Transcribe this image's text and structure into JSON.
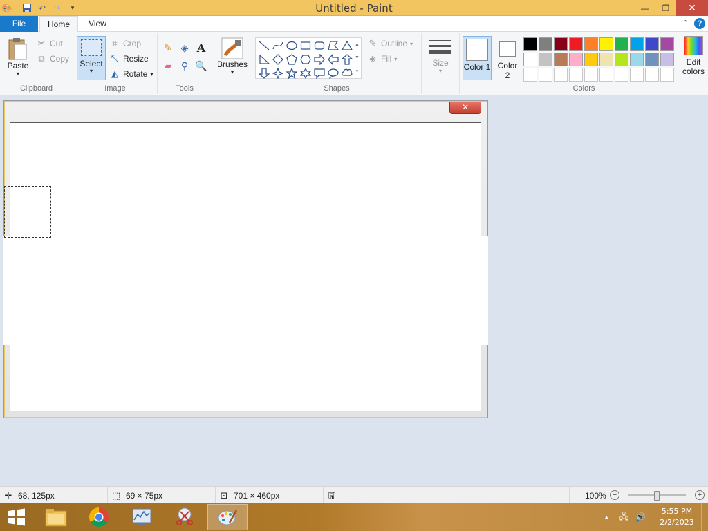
{
  "window": {
    "title": "Untitled - Paint",
    "minimize_glyph": "—",
    "restore_glyph": "❐",
    "close_glyph": "✕"
  },
  "tabs": {
    "file": "File",
    "home": "Home",
    "view": "View"
  },
  "clipboard": {
    "paste": "Paste",
    "cut": "Cut",
    "copy": "Copy",
    "group": "Clipboard"
  },
  "image": {
    "select": "Select",
    "crop": "Crop",
    "resize": "Resize",
    "rotate": "Rotate",
    "group": "Image"
  },
  "tools": {
    "group": "Tools",
    "items": [
      "pencil-icon",
      "fill-icon",
      "text-icon",
      "eraser-icon",
      "color-picker-icon",
      "magnifier-icon"
    ]
  },
  "brushes": {
    "label": "Brushes"
  },
  "shapes": {
    "group": "Shapes",
    "outline": "Outline",
    "fill": "Fill"
  },
  "size": {
    "label": "Size"
  },
  "colors": {
    "color1_label": "Color 1",
    "color2_label": "Color 2",
    "edit_label": "Edit colors",
    "group": "Colors",
    "palette_row1": [
      "#000000",
      "#7f7f7f",
      "#880015",
      "#ed1c24",
      "#ff7f27",
      "#fff200",
      "#22b14c",
      "#00a2e8",
      "#3f48cc",
      "#a349a4"
    ],
    "palette_row2": [
      "#ffffff",
      "#c3c3c3",
      "#b97a57",
      "#ffaec9",
      "#ffc90e",
      "#efe4b0",
      "#b5e61d",
      "#99d9ea",
      "#7092be",
      "#c8bfe7"
    ],
    "palette_row3": [
      "#ffffff",
      "#ffffff",
      "#ffffff",
      "#ffffff",
      "#ffffff",
      "#ffffff",
      "#ffffff",
      "#ffffff",
      "#ffffff",
      "#ffffff"
    ]
  },
  "dialog": {
    "close_glyph": "✕"
  },
  "status": {
    "cursor_pos": "68, 125px",
    "selection_size": "69 × 75px",
    "canvas_size": "701 × 460px",
    "zoom": "100%"
  },
  "taskbar": {
    "time": "5:55 PM",
    "date": "2/2/2023"
  }
}
